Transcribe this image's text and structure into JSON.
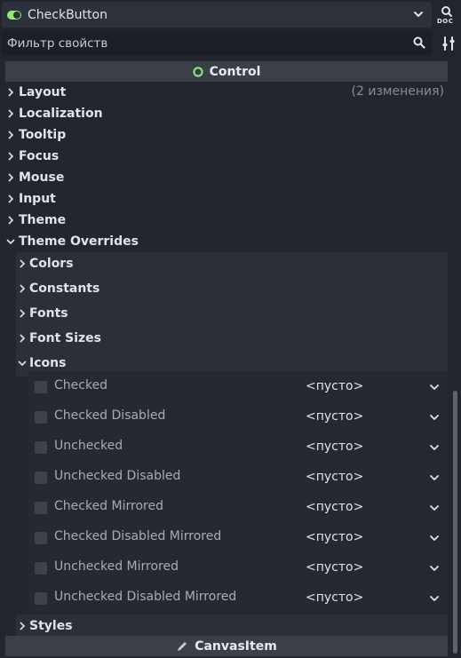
{
  "header": {
    "class_name": "CheckButton",
    "doc_button_label": "DOC"
  },
  "filter": {
    "placeholder": "Фильтр свойств"
  },
  "sections": {
    "control": "Control",
    "canvas_item": "CanvasItem"
  },
  "categories": {
    "layout": "Layout",
    "layout_note": "(2 изменения)",
    "localization": "Localization",
    "tooltip": "Tooltip",
    "focus": "Focus",
    "mouse": "Mouse",
    "input": "Input",
    "theme": "Theme",
    "theme_overrides": "Theme Overrides"
  },
  "subcategories": {
    "colors": "Colors",
    "constants": "Constants",
    "fonts": "Fonts",
    "font_sizes": "Font Sizes",
    "icons": "Icons",
    "styles": "Styles"
  },
  "icon_properties": [
    {
      "name": "Checked",
      "value": "<пусто>"
    },
    {
      "name": "Checked Disabled",
      "value": "<пусто>"
    },
    {
      "name": "Unchecked",
      "value": "<пусто>"
    },
    {
      "name": "Unchecked Disabled",
      "value": "<пусто>"
    },
    {
      "name": "Checked Mirrored",
      "value": "<пусто>"
    },
    {
      "name": "Checked Disabled Mirrored",
      "value": "<пусто>"
    },
    {
      "name": "Unchecked Mirrored",
      "value": "<пусто>"
    },
    {
      "name": "Unchecked Disabled Mirrored",
      "value": "<пусто>"
    }
  ],
  "colors": {
    "accent_green": "#98e67a",
    "panel_bg": "#21262e",
    "section_header_bg": "#3a3f49"
  }
}
